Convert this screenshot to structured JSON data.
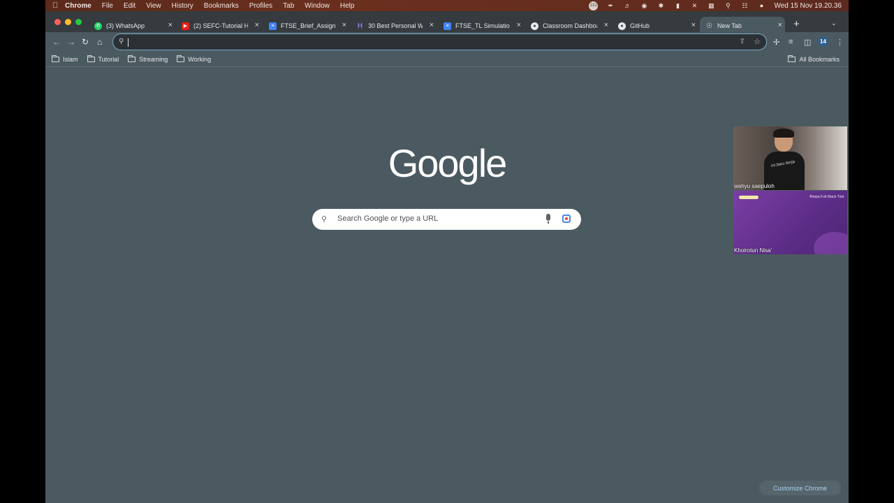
{
  "menubar": {
    "app": "Chrome",
    "menus": [
      "File",
      "Edit",
      "View",
      "History",
      "Bookmarks",
      "Profiles",
      "Tab",
      "Window",
      "Help"
    ],
    "clock": "Wed 15 Nov  19.20.36",
    "notif_badge": "222"
  },
  "tabs": [
    {
      "title": "(3) WhatsApp",
      "icon": "whatsapp-icon"
    },
    {
      "title": "(2) SEFC-Tutorial H",
      "icon": "youtube-icon"
    },
    {
      "title": "FTSE_Brief_Assignm",
      "icon": "docs-icon"
    },
    {
      "title": "30 Best Personal W",
      "icon": "site-icon"
    },
    {
      "title": "FTSE_TL Simulation",
      "icon": "docs-icon"
    },
    {
      "title": "Classroom Dashboa",
      "icon": "github-icon"
    },
    {
      "title": "GitHub",
      "icon": "github-icon"
    },
    {
      "title": "New Tab",
      "icon": "chrome-icon"
    }
  ],
  "toolbar": {
    "profile_initials": "14",
    "address_value": ""
  },
  "bookmarks": {
    "items": [
      "Islam",
      "Tutorial",
      "Streaming",
      "Working"
    ],
    "all": "All Bookmarks"
  },
  "ntp": {
    "logo": "Google",
    "search_placeholder": "Search Google or type a URL",
    "customize": "Customize Chrome"
  },
  "videos": [
    {
      "name": "wahyu saepuloh",
      "shirt_text": "ini baru kerja"
    },
    {
      "name": "Khoirotun Nisa'",
      "slide_text": "Bimpa Full-Stack Trial"
    }
  ],
  "colors": {
    "page_bg": "#4b5a61",
    "tabstrip_bg": "#353b3e",
    "menubar_bg": "#5a2a1c",
    "omnibox_border": "#7ea9c9",
    "customize_text": "#a9d1f0"
  }
}
